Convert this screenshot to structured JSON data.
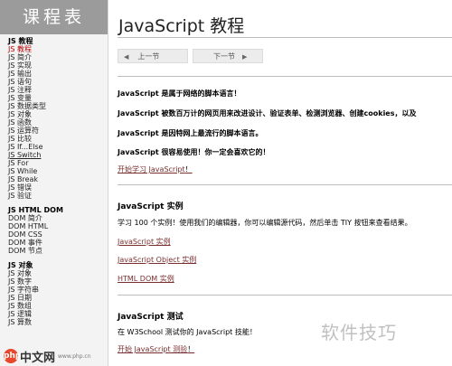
{
  "sidebar": {
    "title": "课程表",
    "groups": [
      {
        "title": "JS 教程",
        "items": [
          "JS 教程",
          "JS 简介",
          "JS 实现",
          "JS 输出",
          "JS 语句",
          "JS 注释",
          "JS 变量",
          "JS 数据类型",
          "JS 对象",
          "JS 函数",
          "JS 运算符",
          "JS 比较",
          "JS If...Else",
          "JS Switch",
          "JS For",
          "JS While",
          "JS Break",
          "JS 错误",
          "JS 验证"
        ]
      },
      {
        "title": "JS HTML DOM",
        "items": [
          "DOM 简介",
          "DOM HTML",
          "DOM CSS",
          "DOM 事件",
          "DOM 节点"
        ]
      },
      {
        "title": "JS 对象",
        "items": [
          "JS 对象",
          "JS 数字",
          "JS 字符串",
          "JS 日期",
          "JS 数组",
          "JS 逻辑",
          "JS 算数"
        ]
      }
    ]
  },
  "main": {
    "title": "JavaScript 教程",
    "pager": {
      "prev": "上一节",
      "next": "下一节"
    },
    "intro": [
      "JavaScript 是属于网络的脚本语言！",
      "JavaScript 被数百万计的网页用来改进设计、验证表单、检测浏览器、创建cookies，以及",
      "JavaScript 是因特网上最流行的脚本语言。",
      "JavaScript 很容易使用！你一定会喜欢它的！"
    ],
    "start_link": "开始学习 JavaScript",
    "start_after": "！",
    "examples": {
      "heading": "JavaScript 实例",
      "description": "学习 100 个实例！使用我们的编辑器，你可以编辑源代码，然后单击 TIY 按钮来查看结果。",
      "links": [
        "JavaScript 实例",
        "JavaScript Object 实例",
        "HTML DOM 实例"
      ]
    },
    "test": {
      "heading": "JavaScript 测试",
      "description": "在 W3School 测试你的 JavaScript 技能！",
      "link": "开始 JavaScript 测验",
      "link_after": "！"
    }
  },
  "watermark": {
    "right_text": "软件技巧",
    "left_logo": "php",
    "left_text": "中文网",
    "left_url": "www.php.cn"
  },
  "colors": {
    "sidebar_header": "#9b9b9b",
    "active_item": "#b00000",
    "link": "#7a2f2f"
  }
}
